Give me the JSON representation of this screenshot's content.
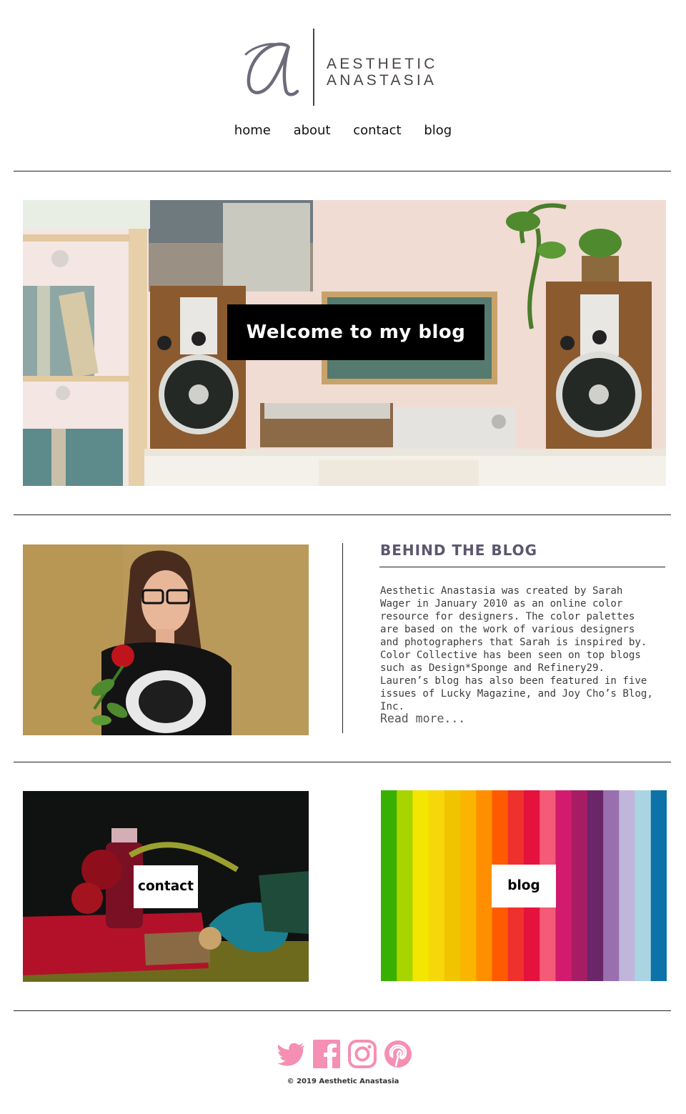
{
  "header": {
    "logo_line1": "AESTHETIC",
    "logo_line2": "ANASTASIA"
  },
  "nav": {
    "items": [
      "home",
      "about",
      "contact",
      "blog"
    ]
  },
  "hero": {
    "title": "Welcome to my blog"
  },
  "about": {
    "heading": "BEHIND THE BLOG",
    "body": "Aesthetic Anastasia was created by Sarah Wager in January 2010 as an online color resource for designers. The color palettes are based on the work of various designers and photographers that Sarah is inspired by. Color Collective has been seen on top blogs such as Design*Sponge and Refinery29. Lauren’s blog has also been featured in five issues of Lucky Magazine, and Joy Cho’s Blog, Inc.",
    "read_more": "Read more..."
  },
  "tiles": {
    "contact_label": "contact",
    "blog_label": "blog"
  },
  "footer": {
    "social_icons": [
      "twitter-icon",
      "facebook-icon",
      "instagram-icon",
      "pinterest-icon"
    ],
    "copyright": "© 2019 Aesthetic Anastasia"
  },
  "colors": {
    "brand_text": "#4a4347",
    "heading": "#5c566e",
    "social_pink": "#f58fb4"
  }
}
